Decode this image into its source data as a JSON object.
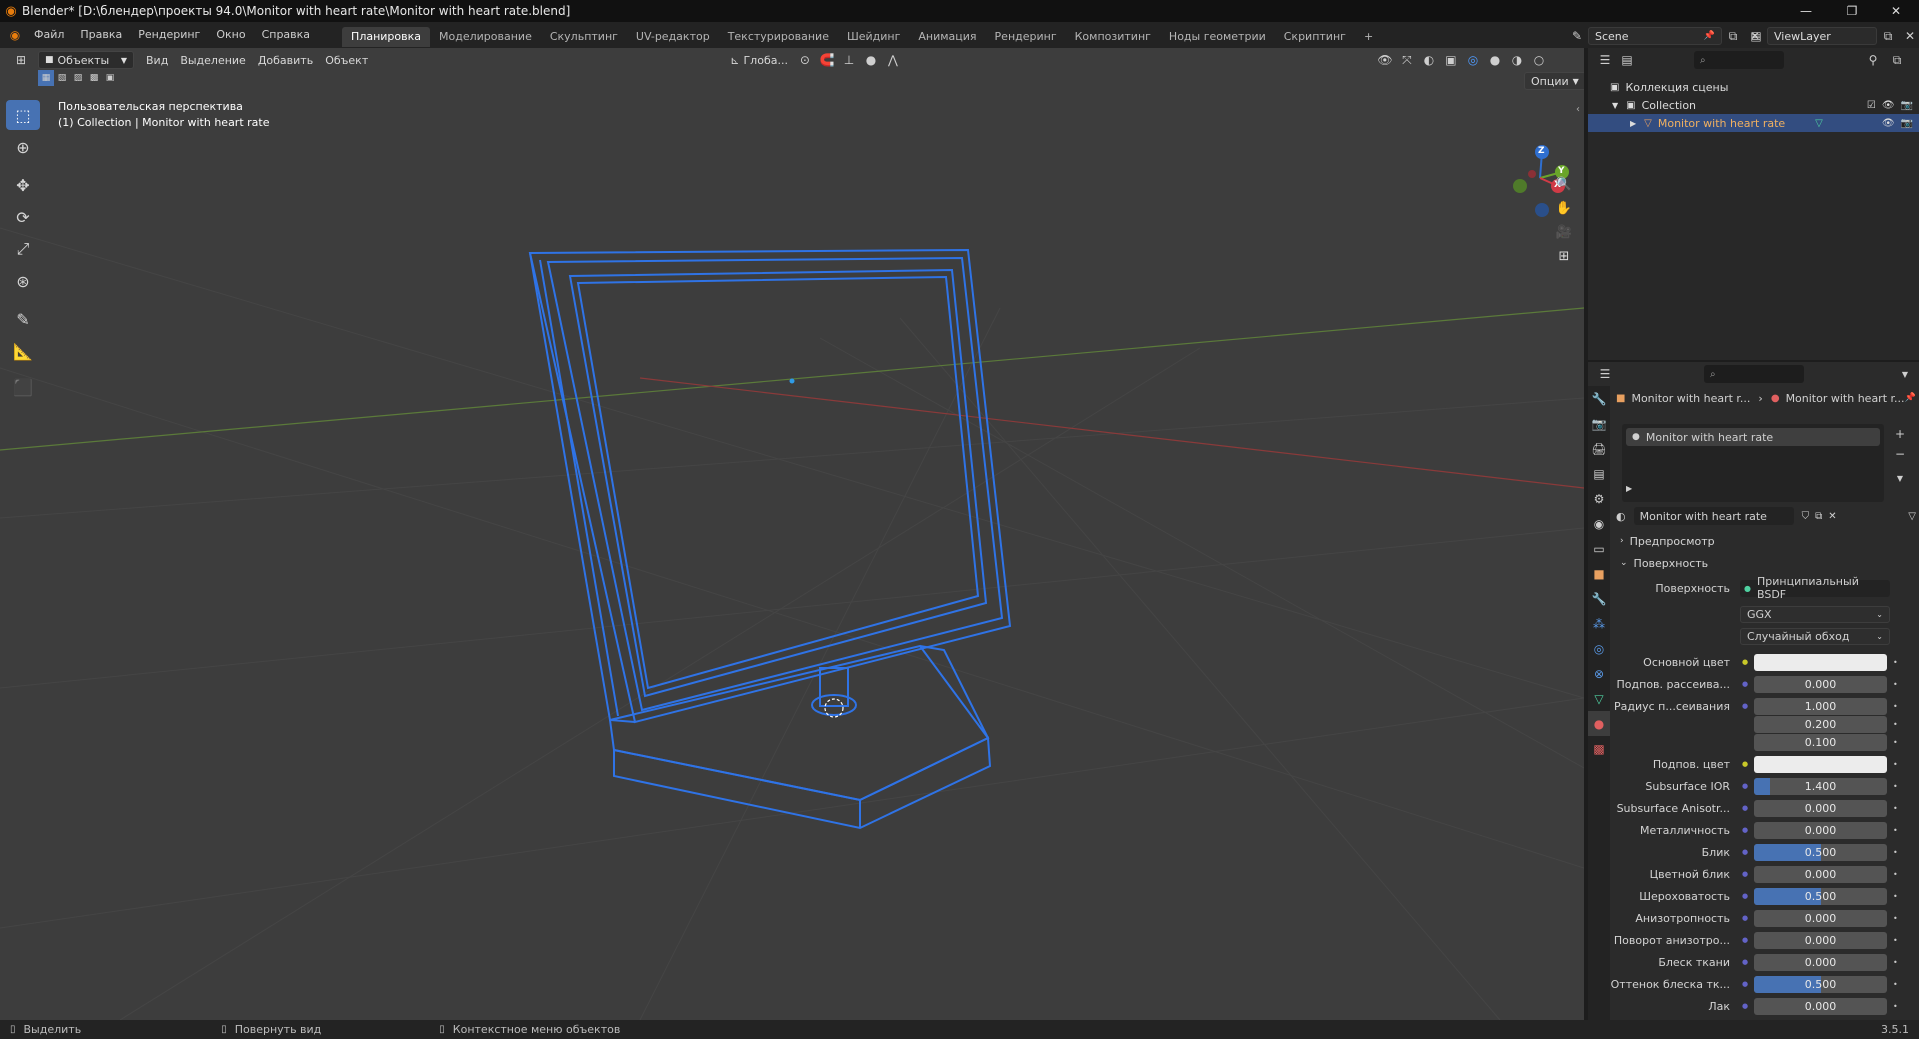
{
  "window": {
    "title": "Blender* [D:\\блендер\\проекты 94.0\\Monitor with heart rate\\Monitor with heart rate.blend]",
    "minimize": "—",
    "maximize": "❐",
    "close": "✕"
  },
  "menu": {
    "items": [
      "Файл",
      "Правка",
      "Рендеринг",
      "Окно",
      "Справка"
    ],
    "workspaces": [
      "Планировка",
      "Моделирование",
      "Скульптинг",
      "UV-редактор",
      "Текстурирование",
      "Шейдинг",
      "Анимация",
      "Рендеринг",
      "Композитинг",
      "Ноды геометрии",
      "Скриптинг"
    ],
    "active_workspace": "Планировка",
    "add_tab": "+",
    "scene_name": "Scene",
    "view_layer": "ViewLayer"
  },
  "viewport": {
    "mode": "Объекты",
    "menus": [
      "Вид",
      "Выделение",
      "Добавить",
      "Объект"
    ],
    "transform_orientation": "Глоба...",
    "options_label": "Опции",
    "perspective_label": "Пользовательская перспектива",
    "collection_label": "(1) Collection | Monitor with heart rate",
    "gizmo": {
      "x": "X",
      "y": "Y",
      "z": "Z"
    },
    "colors": {
      "bg": "#3d3d3d",
      "wire": "#2f73e6",
      "accent": "#4772b3"
    }
  },
  "outliner": {
    "search_placeholder": "",
    "scene_collection": "Коллекция сцены",
    "collection": "Collection",
    "object": "Monitor with heart rate"
  },
  "properties": {
    "breadcrumb_object": "Monitor with heart r...",
    "breadcrumb_material": "Monitor with heart r...",
    "slot_name": "Monitor with heart rate",
    "material_name": "Monitor with heart rate",
    "panel_preview": "Предпросмотр",
    "panel_surface": "Поверхность",
    "surface_label": "Поверхность",
    "surface_value": "Принципиальный BSDF",
    "distribution": "GGX",
    "subsurface_method": "Случайный обход",
    "rows": [
      {
        "label": "Основной цвет",
        "value": "",
        "kind": "color",
        "fill": 0
      },
      {
        "label": "Подпов. рассеива...",
        "value": "0.000",
        "kind": "num",
        "fill": 0
      },
      {
        "label": "Радиус п...сеивания",
        "value": "1.000",
        "kind": "num",
        "fill": 0
      },
      {
        "label": "",
        "value": "0.200",
        "kind": "num",
        "fill": 0
      },
      {
        "label": "",
        "value": "0.100",
        "kind": "num",
        "fill": 0
      },
      {
        "label": "Подпов. цвет",
        "value": "",
        "kind": "color",
        "fill": 0
      },
      {
        "label": "Subsurface IOR",
        "value": "1.400",
        "kind": "num",
        "fill": 0.12
      },
      {
        "label": "Subsurface Anisotr...",
        "value": "0.000",
        "kind": "num",
        "fill": 0
      },
      {
        "label": "Металличность",
        "value": "0.000",
        "kind": "num",
        "fill": 0
      },
      {
        "label": "Блик",
        "value": "0.500",
        "kind": "num",
        "fill": 0.5
      },
      {
        "label": "Цветной блик",
        "value": "0.000",
        "kind": "num",
        "fill": 0
      },
      {
        "label": "Шероховатость",
        "value": "0.500",
        "kind": "num",
        "fill": 0.5
      },
      {
        "label": "Анизотропность",
        "value": "0.000",
        "kind": "num",
        "fill": 0
      },
      {
        "label": "Поворот анизотро...",
        "value": "0.000",
        "kind": "num",
        "fill": 0
      },
      {
        "label": "Блеск ткани",
        "value": "0.000",
        "kind": "num",
        "fill": 0
      },
      {
        "label": "Оттенок блеска тк...",
        "value": "0.500",
        "kind": "num",
        "fill": 0.5
      },
      {
        "label": "Лак",
        "value": "0.000",
        "kind": "num",
        "fill": 0
      }
    ]
  },
  "statusbar": {
    "select": "Выделить",
    "rotate": "Повернуть вид",
    "context": "Контекстное меню объектов",
    "version": "3.5.1"
  }
}
